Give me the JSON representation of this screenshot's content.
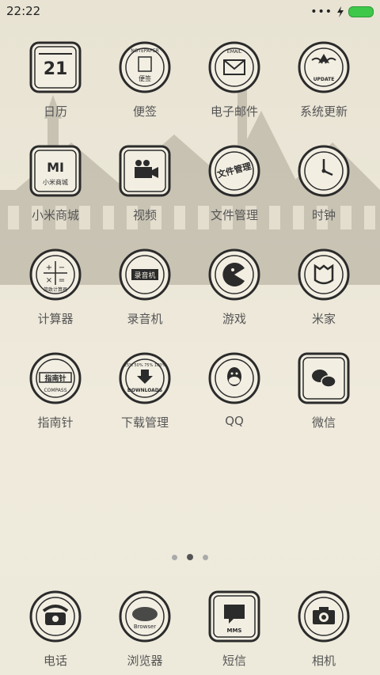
{
  "status": {
    "time": "22:22",
    "battery_color": "#3ec84a"
  },
  "apps": [
    {
      "label": "日历",
      "icon": "calendar-icon",
      "text": "21"
    },
    {
      "label": "便签",
      "icon": "notepaper-icon",
      "text": "NOTEPAPER",
      "sub": "便签"
    },
    {
      "label": "电子邮件",
      "icon": "email-icon",
      "text": "EMAIL"
    },
    {
      "label": "系统更新",
      "icon": "update-icon",
      "text": "UPDATE"
    },
    {
      "label": "小米商城",
      "icon": "mi-store-icon",
      "text": "MI",
      "sub": "小米商城"
    },
    {
      "label": "视频",
      "icon": "video-camera-icon"
    },
    {
      "label": "文件管理",
      "icon": "file-manager-icon",
      "text": "文件管理"
    },
    {
      "label": "时钟",
      "icon": "clock-icon"
    },
    {
      "label": "计算器",
      "icon": "calculator-icon",
      "sub": "简致计算器"
    },
    {
      "label": "录音机",
      "icon": "recorder-icon",
      "text": "录音机"
    },
    {
      "label": "游戏",
      "icon": "game-icon"
    },
    {
      "label": "米家",
      "icon": "mijia-icon"
    },
    {
      "label": "指南针",
      "icon": "compass-icon",
      "text": "指南针",
      "sub": "COMPASS"
    },
    {
      "label": "下载管理",
      "icon": "download-icon",
      "text": "DOWNLOADS",
      "sub": "25% 50% 75% 100%"
    },
    {
      "label": "QQ",
      "icon": "qq-icon"
    },
    {
      "label": "微信",
      "icon": "wechat-icon"
    }
  ],
  "dock": [
    {
      "label": "电话",
      "icon": "phone-icon"
    },
    {
      "label": "浏览器",
      "icon": "browser-icon",
      "text": "Browser"
    },
    {
      "label": "短信",
      "icon": "mms-icon",
      "text": "MMS"
    },
    {
      "label": "相机",
      "icon": "camera-icon"
    }
  ],
  "pager": {
    "pages": 3,
    "active": 2
  }
}
